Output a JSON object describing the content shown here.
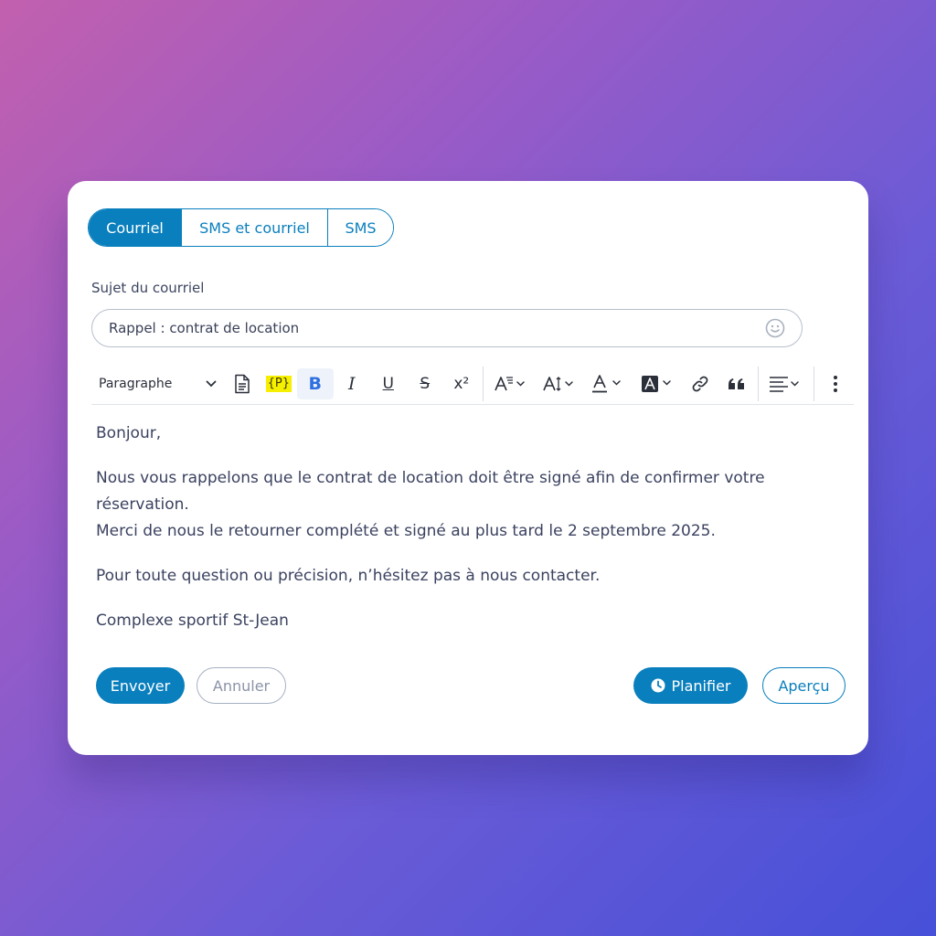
{
  "tabs": [
    {
      "label": "Courriel",
      "active": true
    },
    {
      "label": "SMS et courriel",
      "active": false
    },
    {
      "label": "SMS",
      "active": false
    }
  ],
  "subject": {
    "label": "Sujet du courriel",
    "value": "Rappel : contrat de location",
    "emoji_icon": "smiley-icon"
  },
  "toolbar": {
    "block_format": "Paragraphe",
    "placeholder_badge": "{P}",
    "bold": "B",
    "italic": "I",
    "underline": "U",
    "strike": "S",
    "superscript": "x²",
    "icons": [
      "document-icon",
      "placeholder-icon",
      "bold-icon",
      "italic-icon",
      "underline-icon",
      "strikethrough-icon",
      "superscript-icon",
      "font-family-icon",
      "font-size-icon",
      "font-color-icon",
      "highlight-icon",
      "link-icon",
      "quote-icon",
      "align-icon",
      "more-icon"
    ]
  },
  "body": {
    "greeting": "Bonjour,",
    "line1": "Nous vous rappelons que le contrat de location doit être signé afin de confirmer votre réservation.",
    "line2": "Merci de nous le retourner complété et signé au plus tard le 2 septembre 2025.",
    "line3": "Pour toute question ou précision, n’hésitez pas à nous contacter.",
    "signature": "Complexe sportif St-Jean"
  },
  "actions": {
    "send": "Envoyer",
    "cancel": "Annuler",
    "schedule": "Planifier",
    "preview": "Aperçu"
  },
  "colors": {
    "accent": "#0a7fbd",
    "placeholder_highlight": "#f6f000",
    "bold_active": "#2f6fe0"
  }
}
